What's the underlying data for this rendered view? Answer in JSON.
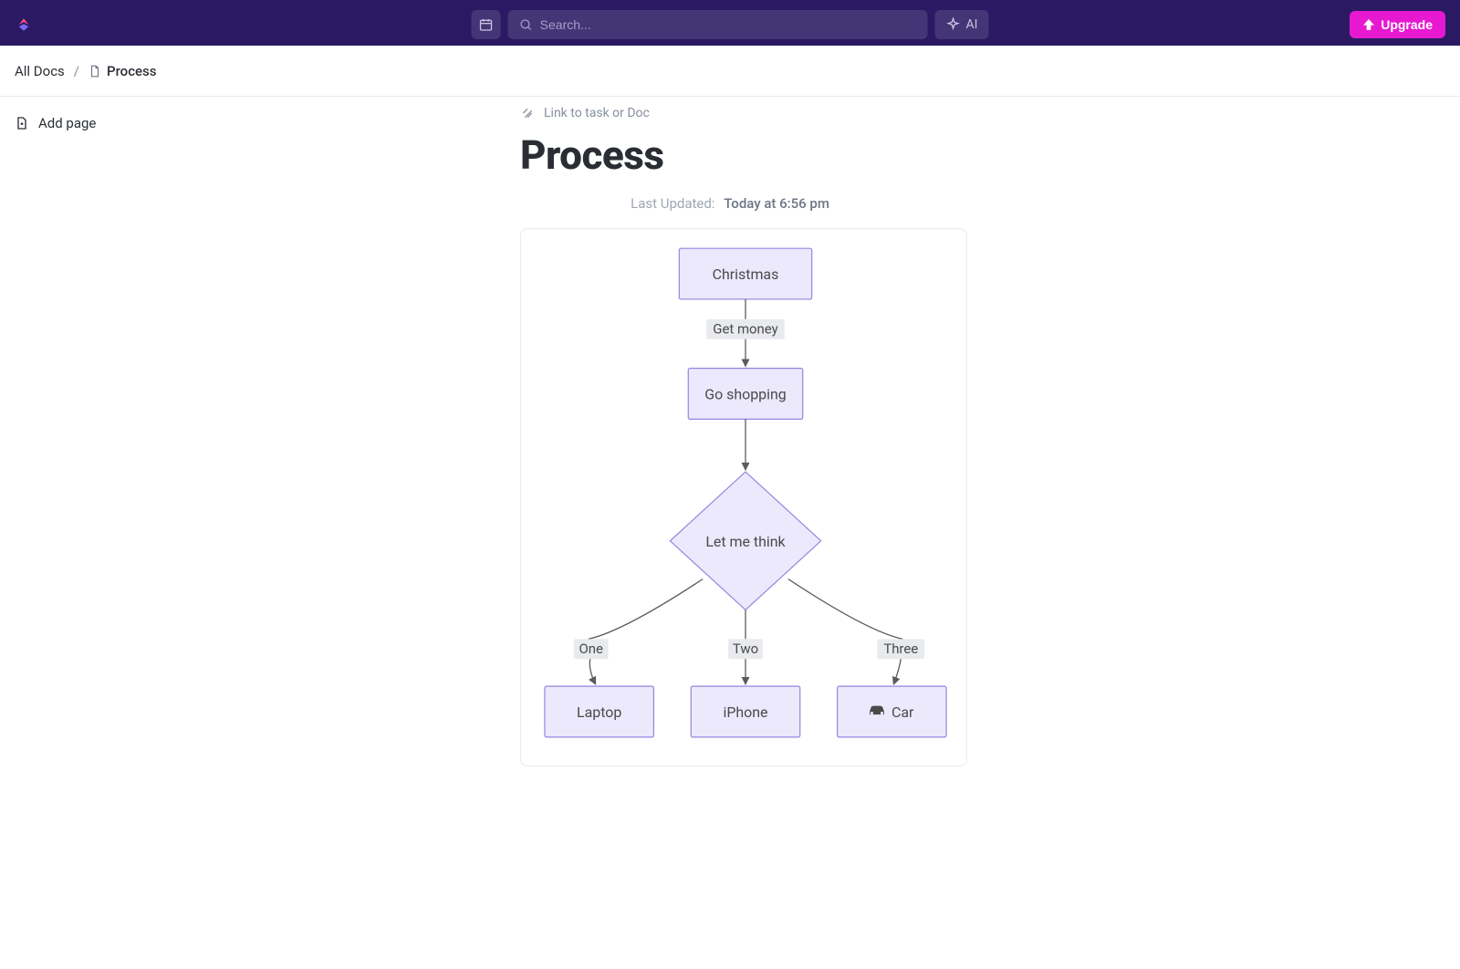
{
  "topbar": {
    "search_placeholder": "Search...",
    "ai_label": "AI",
    "upgrade_label": "Upgrade"
  },
  "breadcrumb": {
    "root": "All Docs",
    "current": "Process"
  },
  "sidebar": {
    "add_page_label": "Add page"
  },
  "doc": {
    "link_task_label": "Link to task or Doc",
    "title": "Process",
    "last_updated_label": "Last Updated:",
    "last_updated_value": "Today at 6:56 pm"
  },
  "diagram": {
    "nodes": {
      "christmas": "Christmas",
      "shopping": "Go shopping",
      "think": "Let me think",
      "laptop": "Laptop",
      "iphone": "iPhone",
      "car": "Car"
    },
    "edges": {
      "get_money": "Get money",
      "one": "One",
      "two": "Two",
      "three": "Three"
    }
  }
}
